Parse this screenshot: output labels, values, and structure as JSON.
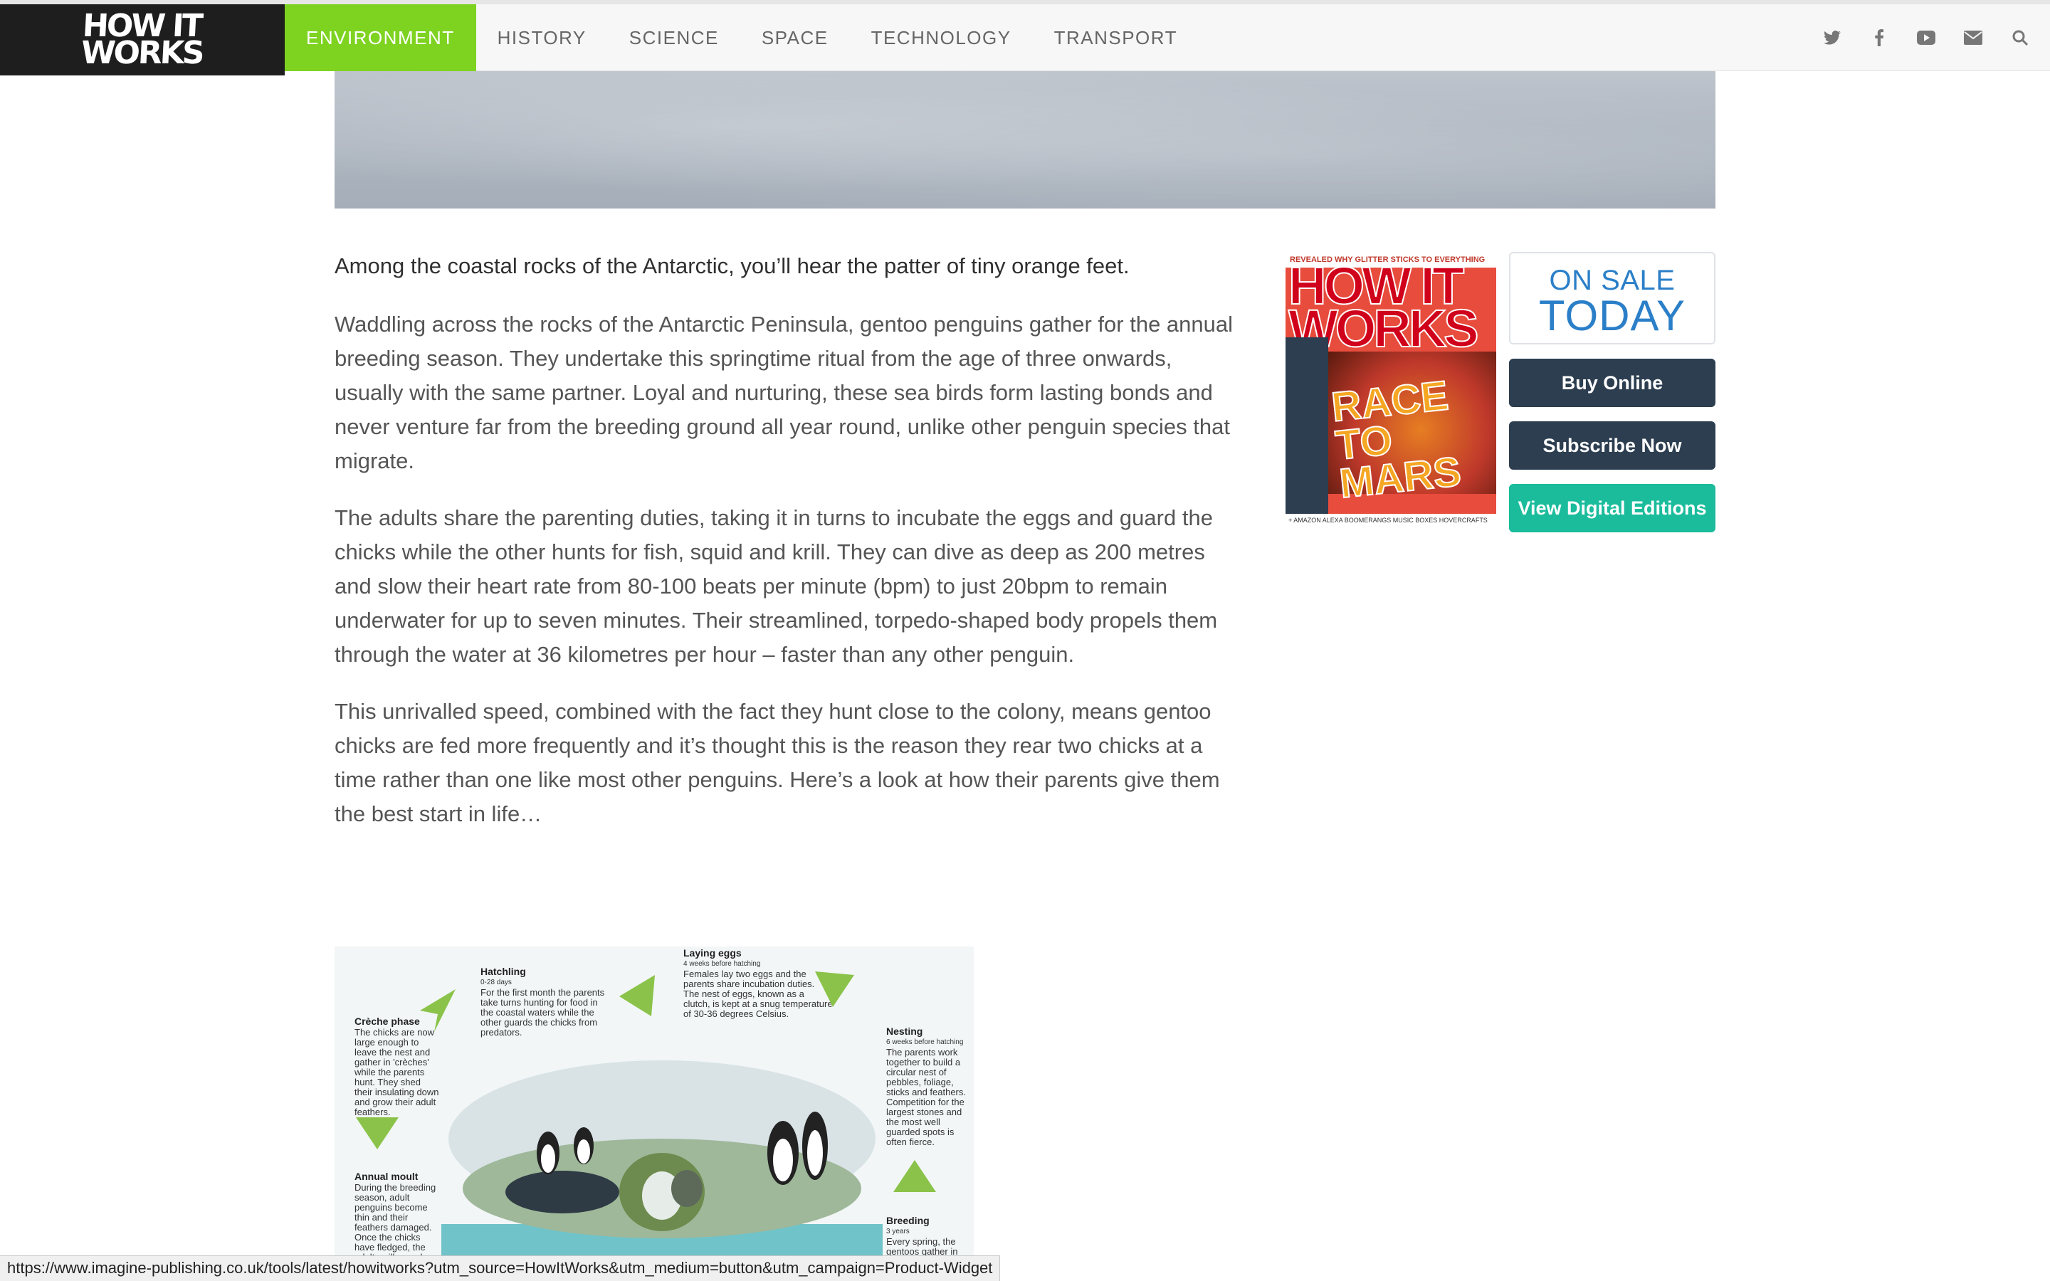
{
  "logo": {
    "text_line1": "HOW IT",
    "text_line2": "WORKS"
  },
  "nav": {
    "items": [
      {
        "label": "ENVIRONMENT",
        "active": true
      },
      {
        "label": "HISTORY"
      },
      {
        "label": "SCIENCE"
      },
      {
        "label": "SPACE"
      },
      {
        "label": "TECHNOLOGY"
      },
      {
        "label": "TRANSPORT"
      }
    ]
  },
  "social": [
    "twitter-icon",
    "facebook-icon",
    "youtube-icon",
    "email-icon",
    "search-icon"
  ],
  "article": {
    "lead": "Among the coastal rocks of the Antarctic, you’ll hear the patter of tiny orange feet.",
    "paragraphs": [
      "Waddling across the rocks of the Antarctic Peninsula, gentoo penguins gather for the annual breeding season. They undertake this springtime ritual from the age of three onwards, usually with the same partner. Loyal and nurturing, these sea birds form lasting bonds and never venture far from the breeding ground all year round, unlike other penguin species that migrate.",
      "The adults share the parenting duties, taking it in turns to incubate the eggs and guard the chicks while the other hunts for fish, squid and krill. They can dive as deep as 200 metres and slow their heart rate from 80-100 beats per minute (bpm) to just 20bpm to remain underwater for up to seven minutes. Their streamlined, torpedo-shaped body propels them through the water at 36 kilometres per hour – faster than any other penguin.",
      "This unrivalled speed, combined with the fact they hunt close to the colony, means gentoo chicks are fed more frequently and it’s thought this is the reason they rear two chicks at a time rather than one like most other penguins. Here’s a look at how their parents give them the best start in life…"
    ]
  },
  "infographic": {
    "hatchling": {
      "title": "Hatchling",
      "sub": "0-28 days",
      "text": "For the first month the parents take turns hunting for food in the coastal waters while the other guards the chicks from predators."
    },
    "laying": {
      "title": "Laying eggs",
      "sub": "4 weeks before hatching",
      "text": "Females lay two eggs and the parents share incubation duties. The nest of eggs, known as a clutch, is kept at a snug temperature of 30-36 degrees Celsius."
    },
    "creche": {
      "title": "Crèche phase",
      "text": "The chicks are now large enough to leave the nest and gather in 'crèches' while the parents hunt. They shed their insulating down and grow their adult feathers."
    },
    "nesting": {
      "title": "Nesting",
      "sub": "6 weeks before hatching",
      "text": "The parents work together to build a circular nest of pebbles, foliage, sticks and feathers. Competition for the largest stones and the most well guarded spots is often fierce."
    },
    "moult": {
      "title": "Annual moult",
      "text": "During the breeding season, adult penguins become thin and their feathers damaged. Once the chicks have fledged, the adults will spend weeks at sea fattening up before their annual"
    },
    "breeding": {
      "title": "Breeding",
      "sub": "3 years",
      "text": "Every spring, the gentoos gather in"
    }
  },
  "sidebar": {
    "cover": {
      "top": "REVEALED WHY GLITTER STICKS TO EVERYTHING",
      "title": "HOW IT WORKS",
      "headline": "RACE TO MARS",
      "bottom": "+ AMAZON ALEXA BOOMERANGS MUSIC BOXES HOVERCRAFTS"
    },
    "onsale_line1": "ON SALE",
    "onsale_line2": "TODAY",
    "buy_label": "Buy Online",
    "subscribe_label": "Subscribe Now",
    "digital_label": "View Digital Editions"
  },
  "status_url": "https://www.imagine-publishing.co.uk/tools/latest/howitworks?utm_source=HowItWorks&utm_medium=button&utm_campaign=Product-Widget",
  "colors": {
    "nav_active": "#7ed321",
    "button_dark": "#2c3e50",
    "button_teal": "#1abc9c",
    "onsale_blue": "#2b7fc8"
  }
}
